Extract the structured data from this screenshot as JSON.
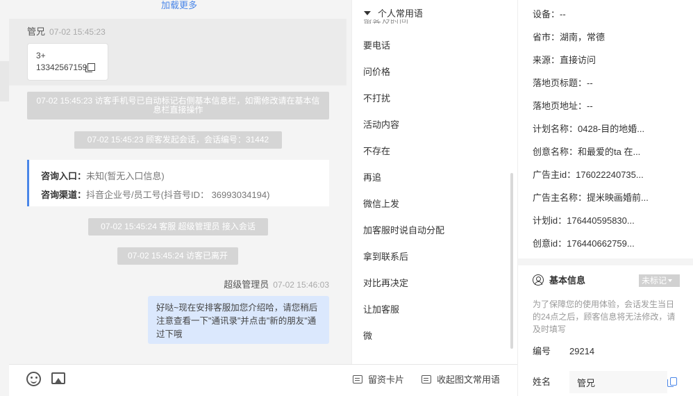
{
  "chat": {
    "load_more": "加载更多",
    "visitor_name": "管兄",
    "visitor_time": "07-02 15:45:23",
    "card_line1": "3+",
    "card_line2": "13342567159",
    "system_messages": [
      "07-02 15:45:23 访客手机号已自动标记右侧基本信息栏，如需修改请在基本信息栏直接操作",
      "07-02 15:45:23 顾客发起会话，会话编号：31442",
      "07-02 15:45:24 客服 超级管理员 接入会话",
      "07-02 15:45:24 访客已离开"
    ],
    "consult": {
      "entry_label": "咨询入口：",
      "entry_value": "未知(暂无入口信息)",
      "channel_label": "咨询渠道：",
      "channel_value": "抖音企业号/员工号(抖音号ID： 36993034194)"
    },
    "agent_name": "超级管理员",
    "agent_time": "07-02 15:46:03",
    "agent_message": "好哒~现在安排客服加您介绍哈，请您稍后注意查看一下\"通讯录\"并点击\"新的朋友\"通过下哦"
  },
  "toolbar": {
    "emoji_icon": "smile-icon",
    "image_icon": "image-icon",
    "leave_card": "留资卡片",
    "collapse_phrases": "收起图文常用语"
  },
  "phrases": {
    "title": "个人常用语",
    "items": [
      "要电话",
      "问价格",
      "不打扰",
      "活动内容",
      "不存在",
      "再追",
      "微信上发",
      "加客服时说自动分配",
      "拿到联系后",
      "对比再决定",
      "让加客服",
      "微"
    ]
  },
  "info": {
    "rows": [
      "设备：--",
      "省市：湖南，常德",
      "来源：直接访问",
      "落地页标题：--",
      "落地页地址：--",
      "计划名称：0428-目的地婚...",
      "创意名称：和最爱的ta 在...",
      "广告主id：176022240735...",
      "广告主名称：提米映画婚前...",
      "计划id：176440595830...",
      "创意id：176440662759..."
    ],
    "basic_title": "基本信息",
    "mark_button": "未标记",
    "notice": "为了保障您的使用体验，会话发生当日的24点之后，顾客信息将无法修改，请及时填写",
    "number_label": "编号",
    "number_value": "29214",
    "name_label": "姓名",
    "name_value": "管兄"
  }
}
